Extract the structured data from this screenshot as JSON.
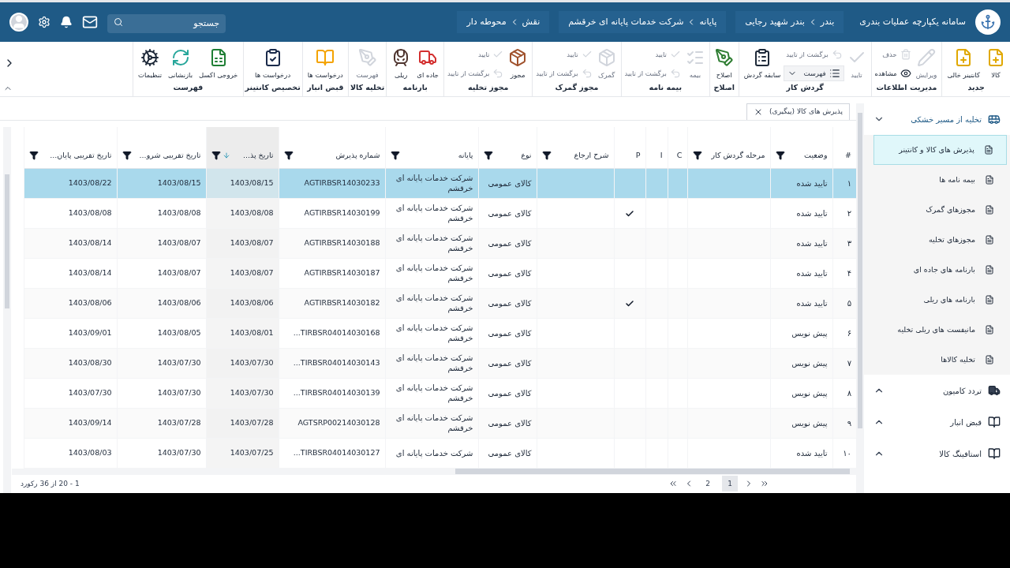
{
  "app": {
    "title": "سامانه یکپارچه عملیات بندری"
  },
  "context_chips": [
    {
      "label": "بندر",
      "value": "بندر شهید رجایی"
    },
    {
      "label": "پایانه",
      "value": "شرکت خدمات پایانه ای خرقشم"
    },
    {
      "label": "نقش",
      "value": "محوطه دار"
    }
  ],
  "search": {
    "placeholder": "جستجو"
  },
  "ribbon": [
    {
      "label": "جدید",
      "items": [
        {
          "label": "کالا",
          "kind": "large",
          "disabled": false
        },
        {
          "label": "کانتینر خالی",
          "kind": "large",
          "disabled": false
        }
      ]
    },
    {
      "label": "مدیریت اطلاعات",
      "items": [
        {
          "label": "ویرایش",
          "kind": "large",
          "disabled": true
        },
        {
          "label": "حذف",
          "kind": "small",
          "disabled": true
        },
        {
          "label": "مشاهده",
          "kind": "small",
          "disabled": false
        }
      ]
    },
    {
      "label": "گردش کار",
      "items": [
        {
          "label": "تایید",
          "kind": "large",
          "disabled": true
        },
        {
          "label": "برگشت از تایید",
          "kind": "small",
          "disabled": true
        },
        {
          "label": "فهرست",
          "kind": "dropdown",
          "disabled": false
        },
        {
          "label": "سابقه گردش",
          "kind": "large",
          "disabled": false
        }
      ]
    },
    {
      "label": "اصلاح",
      "items": [
        {
          "label": "اصلاح",
          "kind": "large",
          "disabled": false
        }
      ]
    },
    {
      "label": "بیمه نامه",
      "items": [
        {
          "label": "بیمه",
          "kind": "large",
          "disabled": true
        },
        {
          "label": "تایید",
          "kind": "small",
          "disabled": true
        },
        {
          "label": "برگشت از تایید",
          "kind": "small",
          "disabled": true
        }
      ]
    },
    {
      "label": "مجوز گمرک",
      "items": [
        {
          "label": "گمرک",
          "kind": "large",
          "disabled": true
        },
        {
          "label": "تایید",
          "kind": "small",
          "disabled": true
        },
        {
          "label": "برگشت از تایید",
          "kind": "small",
          "disabled": true
        }
      ]
    },
    {
      "label": "مجوز تخلیه",
      "items": [
        {
          "label": "مجوز",
          "kind": "large",
          "disabled": false
        },
        {
          "label": "تایید",
          "kind": "small",
          "disabled": true
        },
        {
          "label": "برگشت از تایید",
          "kind": "small",
          "disabled": true
        }
      ]
    },
    {
      "label": "بارنامه",
      "items": [
        {
          "label": "جاده ای",
          "kind": "large",
          "disabled": false
        },
        {
          "label": "ریلی",
          "kind": "large",
          "disabled": false
        }
      ]
    },
    {
      "label": "تخلیه کالا",
      "items": [
        {
          "label": "فهرست",
          "kind": "large",
          "disabled": true
        }
      ]
    },
    {
      "label": "قبض انبار",
      "items": [
        {
          "label": "درخواست ها",
          "kind": "large",
          "disabled": false
        }
      ]
    },
    {
      "label": "تخصیص کانتینر",
      "items": [
        {
          "label": "درخواست ها",
          "kind": "large",
          "disabled": false
        }
      ]
    },
    {
      "label": "فهرست",
      "items": [
        {
          "label": "خروجی اکسل",
          "kind": "large",
          "disabled": false
        },
        {
          "label": "بازنشانی",
          "kind": "large",
          "disabled": false
        },
        {
          "label": "تنظیمات",
          "kind": "large",
          "disabled": false
        }
      ]
    }
  ],
  "sidebar": {
    "sections": [
      {
        "label": "تخلیه از مسیر خشکی",
        "expanded": true,
        "items": [
          {
            "label": "پذیرش های کالا و کانتینر",
            "selected": true
          },
          {
            "label": "بیمه نامه ها",
            "selected": false
          },
          {
            "label": "مجوزهای گمرک",
            "selected": false
          },
          {
            "label": "مجوزهای تخلیه",
            "selected": false
          },
          {
            "label": "بارنامه های جاده ای",
            "selected": false
          },
          {
            "label": "بارنامه های ریلی",
            "selected": false
          },
          {
            "label": "مانیفست های ریلی تخلیه",
            "selected": false
          },
          {
            "label": "تخلیه کالاها",
            "selected": false
          }
        ]
      },
      {
        "label": "تردد کامیون",
        "expanded": false
      },
      {
        "label": "قبض انبار",
        "expanded": false
      },
      {
        "label": "استافینگ کالا",
        "expanded": false
      }
    ]
  },
  "tabs": [
    {
      "label": "پذیرش های کالا (پیگیری)",
      "selected": true
    }
  ],
  "table": {
    "columns": [
      {
        "label": "#",
        "filter": false,
        "sorted": false
      },
      {
        "label": "وضعیت",
        "filter": true,
        "sorted": false
      },
      {
        "label": "مرحله گردش کار",
        "filter": true,
        "sorted": false
      },
      {
        "label": "C",
        "filter": false,
        "sorted": false
      },
      {
        "label": "I",
        "filter": false,
        "sorted": false
      },
      {
        "label": "P",
        "filter": false,
        "sorted": false
      },
      {
        "label": "شرح ارجاع",
        "filter": true,
        "sorted": false
      },
      {
        "label": "نوع",
        "filter": true,
        "sorted": false
      },
      {
        "label": "پایانه",
        "filter": true,
        "sorted": false
      },
      {
        "label": "شماره پذیرش",
        "filter": true,
        "sorted": false
      },
      {
        "label": "تاریخ پذ...",
        "filter": true,
        "sorted": true
      },
      {
        "label": "تاریخ تقریبی شرو...",
        "filter": true,
        "sorted": false
      },
      {
        "label": "تاریخ تقریبی پایان...",
        "filter": true,
        "sorted": false
      }
    ],
    "rows": [
      {
        "num": "۱",
        "status": "تایید شده",
        "p": false,
        "type": "کالای عمومی",
        "terminal": "شرکت خدمات پایانه ای خرقشم",
        "number": "AGTIRBSR14030233",
        "date": "1403/08/15",
        "start": "1403/08/15",
        "end": "1403/08/22",
        "selected": true
      },
      {
        "num": "۲",
        "status": "تایید شده",
        "p": true,
        "type": "کالای عمومی",
        "terminal": "شرکت خدمات پایانه ای خرقشم",
        "number": "AGTIRBSR14030199",
        "date": "1403/08/08",
        "start": "1403/08/08",
        "end": "1403/08/08",
        "selected": false
      },
      {
        "num": "۳",
        "status": "تایید شده",
        "p": false,
        "type": "کالای عمومی",
        "terminal": "شرکت خدمات پایانه ای خرقشم",
        "number": "AGTIRBSR14030188",
        "date": "1403/08/07",
        "start": "1403/08/07",
        "end": "1403/08/14",
        "selected": false
      },
      {
        "num": "۴",
        "status": "تایید شده",
        "p": false,
        "type": "کالای عمومی",
        "terminal": "شرکت خدمات پایانه ای خرقشم",
        "number": "AGTIRBSR14030187",
        "date": "1403/08/07",
        "start": "1403/08/07",
        "end": "1403/08/14",
        "selected": false
      },
      {
        "num": "۵",
        "status": "تایید شده",
        "p": true,
        "type": "کالای عمومی",
        "terminal": "شرکت خدمات پایانه ای خرقشم",
        "number": "AGTIRBSR14030182",
        "date": "1403/08/06",
        "start": "1403/08/06",
        "end": "1403/08/06",
        "selected": false
      },
      {
        "num": "۶",
        "status": "پیش نویس",
        "p": false,
        "type": "کالای عمومی",
        "terminal": "شرکت خدمات پایانه ای خرقشم",
        "number": "...TIRBSR04014030168",
        "date": "1403/08/01",
        "start": "1403/08/05",
        "end": "1403/09/01",
        "selected": false
      },
      {
        "num": "۷",
        "status": "پیش نویس",
        "p": false,
        "type": "کالای عمومی",
        "terminal": "شرکت خدمات پایانه ای خرقشم",
        "number": "...TIRBSR04014030143",
        "date": "1403/07/30",
        "start": "1403/07/30",
        "end": "1403/08/30",
        "selected": false
      },
      {
        "num": "۸",
        "status": "پیش نویس",
        "p": false,
        "type": "کالای عمومی",
        "terminal": "شرکت خدمات پایانه ای خرقشم",
        "number": "...TIRBSR04014030139",
        "date": "1403/07/30",
        "start": "1403/07/30",
        "end": "1403/07/30",
        "selected": false
      },
      {
        "num": "۹",
        "status": "پیش نویس",
        "p": false,
        "type": "کالای عمومی",
        "terminal": "شرکت خدمات پایانه ای خرقشم",
        "number": "AGTSRP00214030128",
        "date": "1403/07/28",
        "start": "1403/07/28",
        "end": "1403/09/14",
        "selected": false
      },
      {
        "num": "۱۰",
        "status": "تایید شده",
        "p": false,
        "type": "کالای عمومی",
        "terminal": "شرکت خدمات پایانه ای",
        "number": "...TIRBSR04014030127",
        "date": "1403/07/25",
        "start": "1403/07/30",
        "end": "1403/08/03",
        "selected": false
      }
    ]
  },
  "pager": {
    "pages": [
      {
        "label": "1",
        "selected": true
      },
      {
        "label": "2",
        "selected": false
      }
    ],
    "summary": "1 - 20 از 36 رکورد"
  }
}
